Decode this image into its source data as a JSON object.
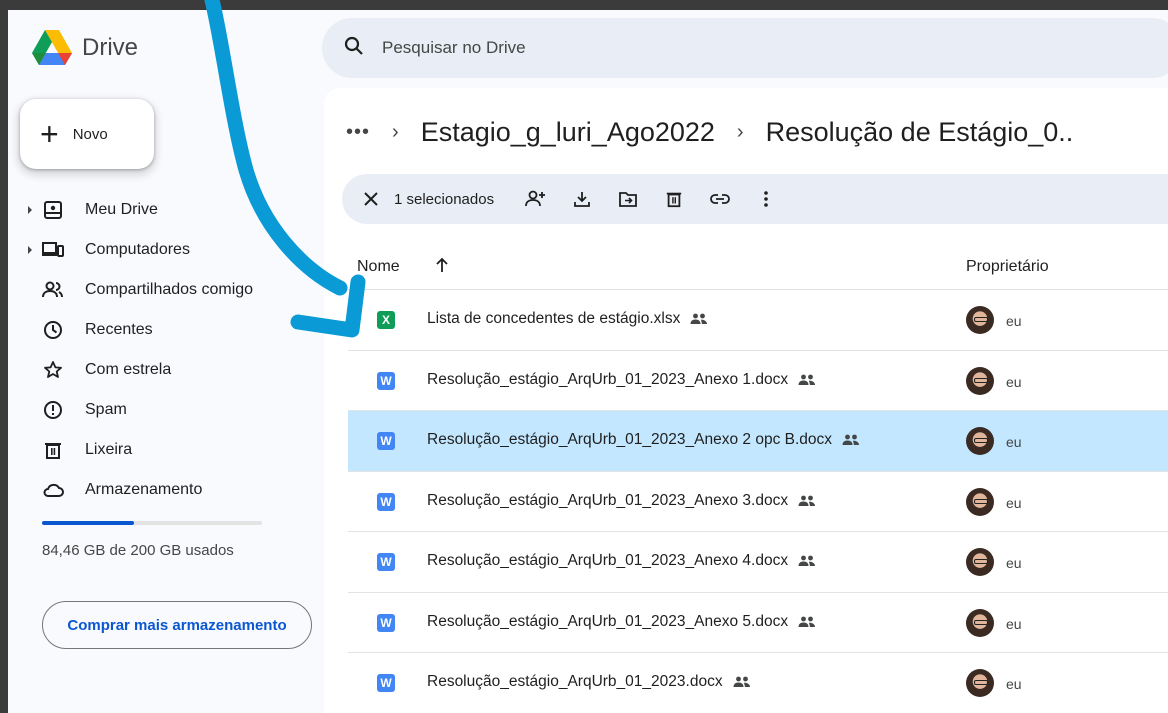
{
  "app": {
    "name": "Drive"
  },
  "sidebar": {
    "new_label": "Novo",
    "items": [
      {
        "label": "Meu Drive",
        "icon": "my-drive-icon",
        "expandable": true
      },
      {
        "label": "Computadores",
        "icon": "computers-icon",
        "expandable": true
      },
      {
        "label": "Compartilhados comigo",
        "icon": "shared-with-me-icon",
        "expandable": false
      },
      {
        "label": "Recentes",
        "icon": "clock-icon",
        "expandable": false
      },
      {
        "label": "Com estrela",
        "icon": "star-icon",
        "expandable": false
      },
      {
        "label": "Spam",
        "icon": "spam-icon",
        "expandable": false
      },
      {
        "label": "Lixeira",
        "icon": "trash-icon",
        "expandable": false
      },
      {
        "label": "Armazenamento",
        "icon": "cloud-icon",
        "expandable": false
      }
    ],
    "storage": {
      "text": "84,46 GB de 200 GB usados",
      "used_fraction": 0.42
    },
    "buy_label": "Comprar mais armazenamento"
  },
  "search": {
    "placeholder": "Pesquisar no Drive"
  },
  "breadcrumb": {
    "more": "•••",
    "separator": "›",
    "items": [
      "Estagio_g_luri_Ago2022",
      "Resolução de Estágio_0.."
    ]
  },
  "selection_bar": {
    "count_label": "1 selecionados",
    "actions": [
      "share-icon",
      "download-icon",
      "move-icon",
      "trash-icon",
      "link-icon",
      "more-vert-icon"
    ]
  },
  "table": {
    "headers": {
      "name": "Nome",
      "owner": "Proprietário"
    },
    "rows": [
      {
        "name": "Lista de concedentes de estágio.xlsx",
        "type": "xlsx",
        "owner": "eu",
        "selected": false
      },
      {
        "name": "Resolução_estágio_ArqUrb_01_2023_Anexo 1.docx",
        "type": "docx",
        "owner": "eu",
        "selected": false
      },
      {
        "name": "Resolução_estágio_ArqUrb_01_2023_Anexo 2 opc B.docx",
        "type": "docx",
        "owner": "eu",
        "selected": true
      },
      {
        "name": "Resolução_estágio_ArqUrb_01_2023_Anexo 3.docx",
        "type": "docx",
        "owner": "eu",
        "selected": false
      },
      {
        "name": "Resolução_estágio_ArqUrb_01_2023_Anexo 4.docx",
        "type": "docx",
        "owner": "eu",
        "selected": false
      },
      {
        "name": "Resolução_estágio_ArqUrb_01_2023_Anexo 5.docx",
        "type": "docx",
        "owner": "eu",
        "selected": false
      },
      {
        "name": "Resolução_estágio_ArqUrb_01_2023.docx",
        "type": "docx",
        "owner": "eu",
        "selected": false
      }
    ],
    "file_icons": {
      "xlsx": {
        "letter": "X",
        "color": "#0f9d58"
      },
      "docx": {
        "letter": "W",
        "color": "#4285f4"
      }
    }
  },
  "colors": {
    "accent": "#0b57d0",
    "selected_row": "#c2e7ff",
    "annotation": "#0a9ad6"
  }
}
